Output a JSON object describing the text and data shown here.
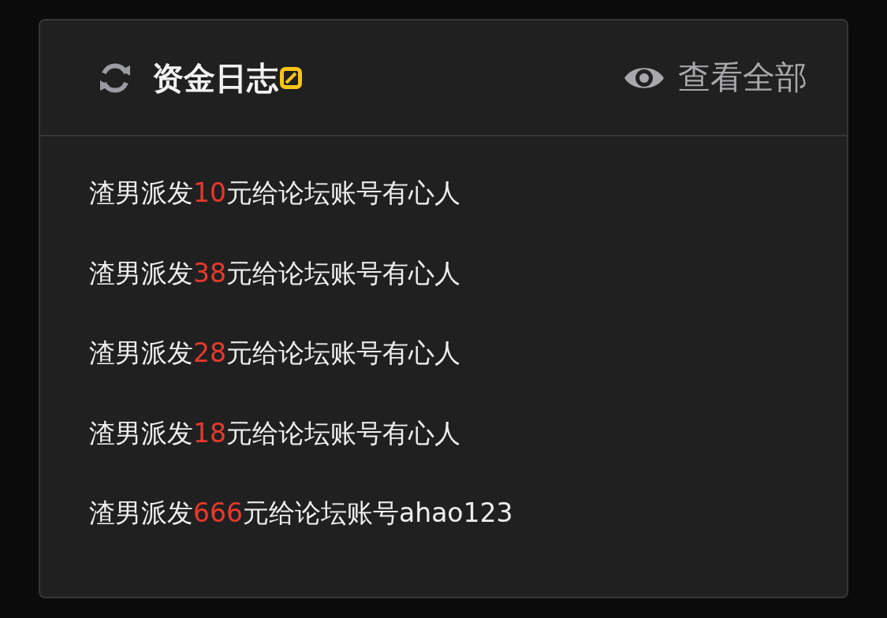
{
  "header": {
    "title": "资金日志",
    "view_all": "查看全部"
  },
  "logs": [
    {
      "prefix": "渣男派发",
      "amount": "10",
      "suffix": "元给论坛账号有心人"
    },
    {
      "prefix": "渣男派发",
      "amount": "38",
      "suffix": "元给论坛账号有心人"
    },
    {
      "prefix": "渣男派发",
      "amount": "28",
      "suffix": "元给论坛账号有心人"
    },
    {
      "prefix": "渣男派发",
      "amount": "18",
      "suffix": "元给论坛账号有心人"
    },
    {
      "prefix": "渣男派发",
      "amount": "666",
      "suffix": "元给论坛账号ahao123"
    }
  ]
}
